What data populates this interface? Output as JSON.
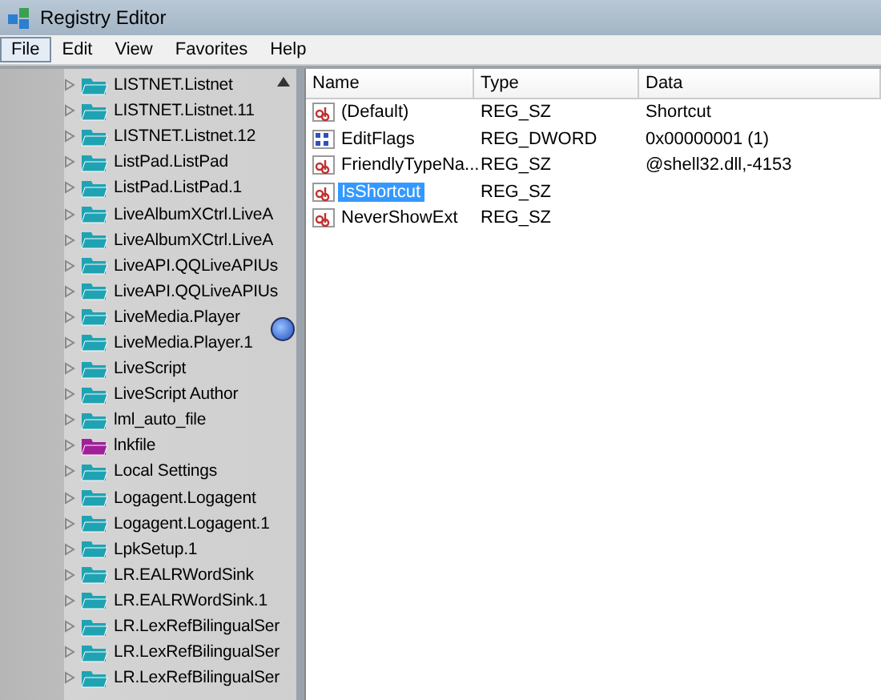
{
  "window": {
    "title": "Registry Editor"
  },
  "menu": [
    {
      "label": "File",
      "selected": true
    },
    {
      "label": "Edit",
      "selected": false
    },
    {
      "label": "View",
      "selected": false
    },
    {
      "label": "Favorites",
      "selected": false
    },
    {
      "label": "Help",
      "selected": false
    }
  ],
  "tree": [
    {
      "label": "LISTNET.Listnet",
      "color": "#1fa3b3"
    },
    {
      "label": "LISTNET.Listnet.11",
      "color": "#1fa3b3"
    },
    {
      "label": "LISTNET.Listnet.12",
      "color": "#1fa3b3"
    },
    {
      "label": "ListPad.ListPad",
      "color": "#1fa3b3"
    },
    {
      "label": "ListPad.ListPad.1",
      "color": "#1fa3b3"
    },
    {
      "label": "LiveAlbumXCtrl.LiveA",
      "color": "#1fa3b3"
    },
    {
      "label": "LiveAlbumXCtrl.LiveA",
      "color": "#1fa3b3"
    },
    {
      "label": "LiveAPI.QQLiveAPIUs",
      "color": "#1fa3b3"
    },
    {
      "label": "LiveAPI.QQLiveAPIUs",
      "color": "#1fa3b3"
    },
    {
      "label": "LiveMedia.Player",
      "color": "#1fa3b3"
    },
    {
      "label": "LiveMedia.Player.1",
      "color": "#1fa3b3"
    },
    {
      "label": "LiveScript",
      "color": "#1fa3b3"
    },
    {
      "label": "LiveScript Author",
      "color": "#1fa3b3"
    },
    {
      "label": "lml_auto_file",
      "color": "#1fa3b3"
    },
    {
      "label": "lnkfile",
      "color": "#a0209a"
    },
    {
      "label": "Local Settings",
      "color": "#1fa3b3"
    },
    {
      "label": "Logagent.Logagent",
      "color": "#1fa3b3"
    },
    {
      "label": "Logagent.Logagent.1",
      "color": "#1fa3b3"
    },
    {
      "label": "LpkSetup.1",
      "color": "#1fa3b3"
    },
    {
      "label": "LR.EALRWordSink",
      "color": "#1fa3b3"
    },
    {
      "label": "LR.EALRWordSink.1",
      "color": "#1fa3b3"
    },
    {
      "label": "LR.LexRefBilingualSer",
      "color": "#1fa3b3"
    },
    {
      "label": "LR.LexRefBilingualSer",
      "color": "#1fa3b3"
    },
    {
      "label": "LR.LexRefBilingualSer",
      "color": "#1fa3b3"
    }
  ],
  "table": {
    "columns": [
      "Name",
      "Type",
      "Data"
    ],
    "rows": [
      {
        "kind": "string",
        "name": "(Default)",
        "type": "REG_SZ",
        "data": "Shortcut",
        "selected": false
      },
      {
        "kind": "binary",
        "name": "EditFlags",
        "type": "REG_DWORD",
        "data": "0x00000001 (1)",
        "selected": false
      },
      {
        "kind": "string",
        "name": "FriendlyTypeNa...",
        "type": "REG_SZ",
        "data": "@shell32.dll,-4153",
        "selected": false
      },
      {
        "kind": "string",
        "name": "IsShortcut",
        "type": "REG_SZ",
        "selected": true
      },
      {
        "kind": "string",
        "name": "NeverShowExt",
        "type": "REG_SZ",
        "selected": false
      }
    ]
  }
}
